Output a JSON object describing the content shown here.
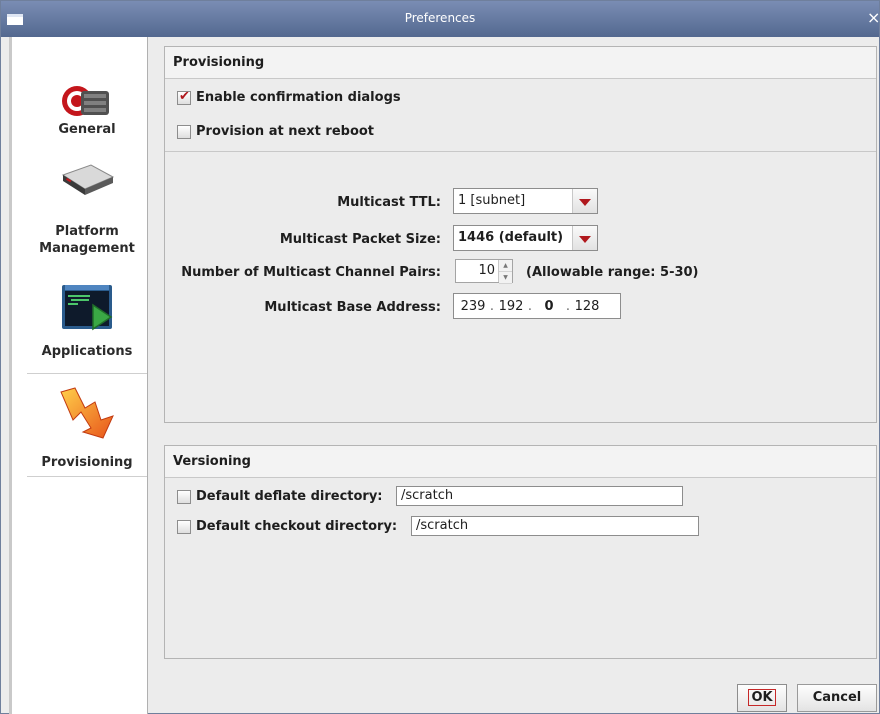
{
  "window": {
    "title": "Preferences",
    "close_glyph": "×"
  },
  "sidebar": {
    "items": [
      {
        "label": "General",
        "icon": "general-icon",
        "selected": false
      },
      {
        "label": "Platform Management",
        "icon": "platform-icon",
        "selected": false
      },
      {
        "label": "Applications",
        "icon": "applications-icon",
        "selected": false
      },
      {
        "label": "Provisioning",
        "icon": "provisioning-icon",
        "selected": true
      }
    ]
  },
  "provisioning": {
    "header": "Provisioning",
    "enable_confirmation": {
      "label": "Enable confirmation dialogs",
      "checked": true
    },
    "provision_reboot": {
      "label": "Provision at next reboot",
      "checked": false
    },
    "multicast_ttl": {
      "label": "Multicast TTL:",
      "value": "1 [subnet]"
    },
    "packet_size": {
      "label": "Multicast Packet Size:",
      "value": "1446 (default)"
    },
    "channel_pairs": {
      "label": "Number of Multicast Channel Pairs:",
      "value": "10",
      "hint": "(Allowable range: 5-30)"
    },
    "base_address": {
      "label": "Multicast Base Address:",
      "octets": [
        "239",
        "192",
        "0",
        "128"
      ]
    }
  },
  "versioning": {
    "header": "Versioning",
    "deflate": {
      "label": "Default deflate directory:",
      "value": "/scratch",
      "checked": false
    },
    "checkout": {
      "label": "Default checkout directory:",
      "value": "/scratch",
      "checked": false
    }
  },
  "footer": {
    "ok_label": "OK",
    "cancel_label": "Cancel"
  },
  "colors": {
    "accent": "#b0181d",
    "titlebar": "#6479a2"
  }
}
